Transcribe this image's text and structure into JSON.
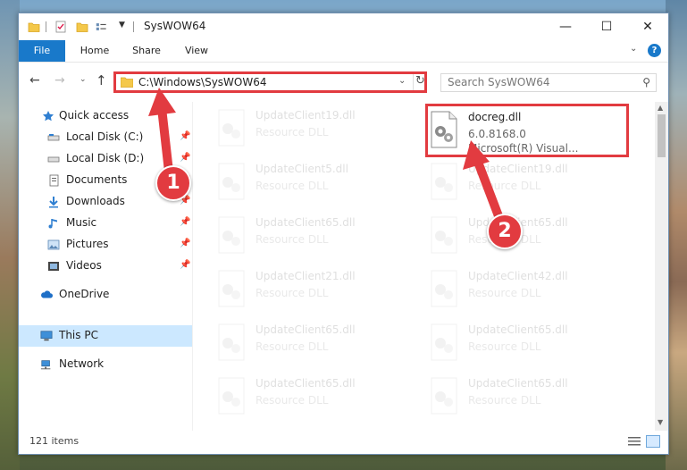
{
  "window": {
    "title": "SysWOW64",
    "controls": {
      "minimize": "—",
      "maximize": "☐",
      "close": "✕"
    }
  },
  "ribbon": {
    "tabs": [
      "File",
      "Home",
      "Share",
      "View"
    ]
  },
  "address_bar": {
    "path": "C:\\Windows\\SysWOW64"
  },
  "search": {
    "placeholder": "Search SysWOW64"
  },
  "sidebar": {
    "items": [
      {
        "label": "Quick access",
        "icon": "star-icon"
      },
      {
        "label": "Local Disk (C:)",
        "icon": "drive-icon",
        "pinned": true
      },
      {
        "label": "Local Disk (D:)",
        "icon": "drive-icon",
        "pinned": true
      },
      {
        "label": "Documents",
        "icon": "documents-icon",
        "pinned": true
      },
      {
        "label": "Downloads",
        "icon": "downloads-icon",
        "pinned": true
      },
      {
        "label": "Music",
        "icon": "music-icon",
        "pinned": true
      },
      {
        "label": "Pictures",
        "icon": "pictures-icon",
        "pinned": true
      },
      {
        "label": "Videos",
        "icon": "videos-icon",
        "pinned": true
      },
      {
        "label": "OneDrive",
        "icon": "cloud-icon"
      },
      {
        "label": "This PC",
        "icon": "computer-icon",
        "selected": true
      },
      {
        "label": "Network",
        "icon": "network-icon"
      }
    ]
  },
  "files": {
    "highlighted": {
      "name": "docreg.dll",
      "version": "6.0.8168.0",
      "company": "Microsoft(R) Visual..."
    },
    "faded": [
      {
        "name": "UpdateClient19.dll",
        "type": "Resource DLL"
      },
      {
        "name": "UpdateClient5.dll",
        "type": "Resource DLL"
      },
      {
        "name": "UpdateClient19.dll",
        "type": "Resource DLL"
      },
      {
        "name": "UpdateClient65.dll",
        "type": "Resource DLL"
      },
      {
        "name": "UpdateClient65.dll",
        "type": "Resource DLL"
      },
      {
        "name": "UpdateClient21.dll",
        "type": "Resource DLL"
      },
      {
        "name": "UpdateClient42.dll",
        "type": "Resource DLL"
      },
      {
        "name": "UpdateClient65.dll",
        "type": "Resource DLL"
      },
      {
        "name": "UpdateClient65.dll",
        "type": "Resource DLL"
      },
      {
        "name": "UpdateClient65.dll",
        "type": "Resource DLL"
      },
      {
        "name": "UpdateClient65.dll",
        "type": "Resource DLL"
      }
    ]
  },
  "status": {
    "item_count": "121 items"
  },
  "annotations": {
    "badge_1": "1",
    "badge_2": "2",
    "color": "#e23b40"
  }
}
